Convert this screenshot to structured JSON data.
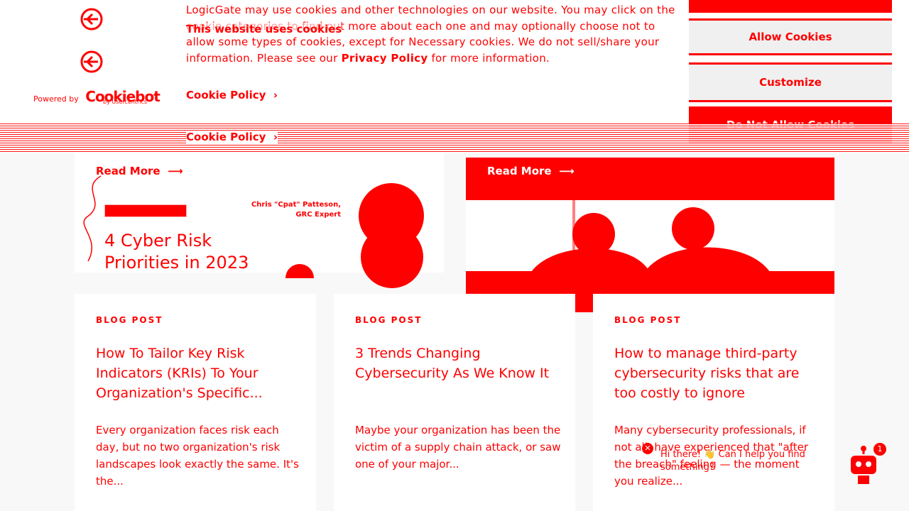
{
  "banner": {
    "heading": "This website uses cookies",
    "body_text": "LogicGate may use cookies and other technologies on our website. You may click on the cookie categories to find out more about each one and may optionally choose not to allow some types of cookies, except for Necessary cookies.  We do not sell/share your information. Please see our Privacy Policy for more information.",
    "body_prefix": "LogicGate may use cookies and other technologies on our website. You may click on the cookie categories to find out more about each one and may optionally choose not to allow some types of cookies, except for Necessary cookies.  We do not sell/share your information. Please see our ",
    "privacy_link": "Privacy Policy",
    "body_suffix": " for more information.",
    "cookie_policy_link": "Cookie Policy",
    "powered_by": "Powered by",
    "cookiebot_name": "Cookiebot",
    "cookiebot_sub": "by Usercentrics",
    "buttons": {
      "allow": "Allow Cookies",
      "customize": "Customize",
      "deny": "Do Not Allow Cookies"
    }
  },
  "featured": {
    "read_more": "Read More",
    "title": "4 Cyber Risk Priorities in 2023",
    "author_name": "Chris \"Cpat\" Patteson,",
    "author_role": "GRC Expert"
  },
  "hero": {
    "read_more": "Read More"
  },
  "cards": [
    {
      "eyebrow": "BLOG POST",
      "title": "How To Tailor Key Risk Indicators (KRIs) To Your Organization's Specific...",
      "excerpt": "Every organization faces risk each day, but no two organization's risk landscapes look exactly the same. It's the..."
    },
    {
      "eyebrow": "BLOG POST",
      "title": "3 Trends Changing Cybersecurity As We Know It",
      "excerpt": "Maybe your organization has been the victim of a supply chain attack, or saw one of your major..."
    },
    {
      "eyebrow": "BLOG POST",
      "title": "How to manage third-party cybersecurity risks that are too costly to ignore",
      "excerpt": "Many cybersecurity professionals, if not all, have experienced that \"after the breach\" feeling — the moment you realize..."
    }
  ],
  "chat": {
    "greeting": "Hi there! 👋 Can I help you find something?",
    "badge_count": "1"
  },
  "colors": {
    "accent": "#ff0000",
    "background": "#f8f8f8"
  }
}
